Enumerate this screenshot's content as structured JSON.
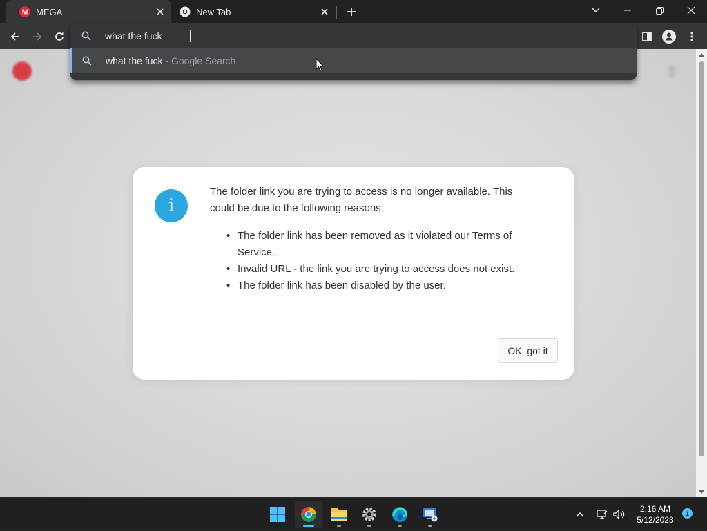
{
  "browser": {
    "tabs": [
      {
        "title": "MEGA",
        "favicon": "mega-icon",
        "active": true
      },
      {
        "title": "New Tab",
        "favicon": "chrome-icon",
        "active": false
      }
    ]
  },
  "omnibox": {
    "input_value": "what the fuck",
    "suggestion": {
      "query": "what the fuck",
      "source": " - Google Search"
    }
  },
  "dialog": {
    "message": "The folder link you are trying to access is no longer available. This could be due to the following reasons:",
    "reasons": [
      "The folder link has been removed as it violated our Terms of Service.",
      "Invalid URL - the link you are trying to access does not exist.",
      "The folder link has been disabled by the user."
    ],
    "ok_label": "OK, got it",
    "icon": "info-icon",
    "icon_glyph": "i"
  },
  "taskbar": {
    "apps": [
      "windows-start-icon",
      "chrome-icon",
      "file-explorer-icon",
      "settings-icon",
      "edge-icon",
      "remote-desktop-icon"
    ],
    "time": "2:16 AM",
    "date": "5/12/2023",
    "notification_count": "1"
  },
  "colors": {
    "accent": "#2ba6de",
    "mega_red": "#d9272e",
    "suggest_highlight": "#8ab4f8"
  }
}
